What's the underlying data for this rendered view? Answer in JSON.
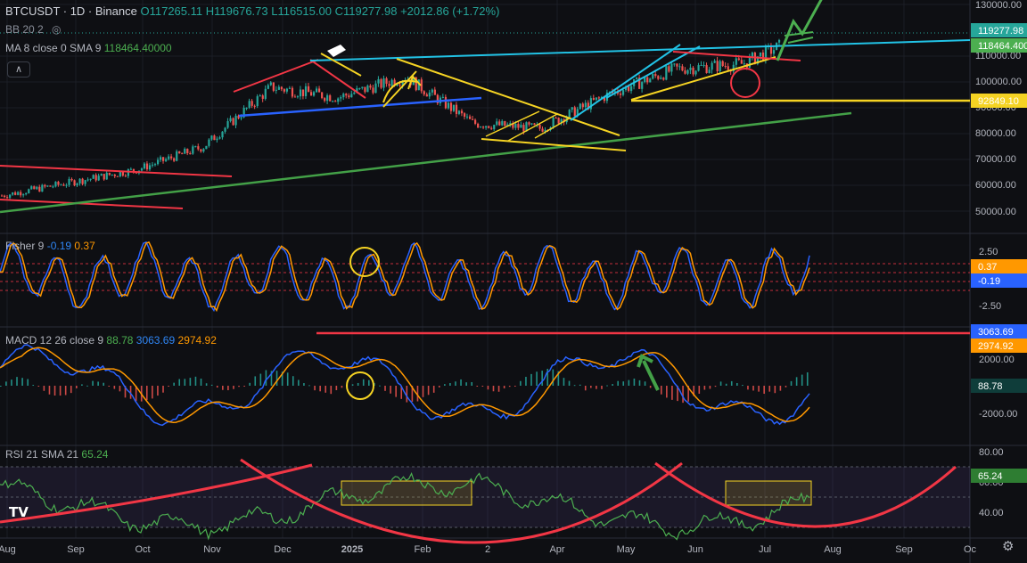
{
  "header": {
    "symbol": "BTCUSDT · 1D · Binance",
    "open": "O117265.11",
    "high": "H119676.73",
    "low": "L116515.00",
    "close": "C119277.98",
    "change": "+2012.86 (+1.72%)",
    "bb_label": "BB 20 2",
    "eye_icon": "eye-off-icon",
    "ma_label": "MA 8 close 0 SMA 9",
    "ma_value": "118464.40000",
    "collapse_icon": "chevron-up-icon"
  },
  "price_axis": {
    "ticks": [
      "130000.00",
      "110000.00",
      "100000.00",
      "90000.00",
      "80000.00",
      "70000.00",
      "60000.00",
      "50000.00"
    ],
    "tags": [
      {
        "text": "119277.98",
        "color": "#26a69a"
      },
      {
        "text": "118464.400",
        "color": "#4caf50"
      },
      {
        "text": "92849.10",
        "color": "#f5d323"
      }
    ]
  },
  "fisher": {
    "label": "Fisher 9",
    "v1": "-0.19",
    "v2": "0.37",
    "ticks": [
      "2.50",
      "-2.50"
    ],
    "tags": [
      {
        "text": "0.37",
        "color": "#ff9800"
      },
      {
        "text": "-0.19",
        "color": "#2962ff"
      }
    ]
  },
  "macd": {
    "label": "MACD 12 26 close 9",
    "hist": "88.78",
    "macd": "3063.69",
    "signal": "2974.92",
    "ticks": [
      "2000.00",
      "-2000.00"
    ],
    "tags": [
      {
        "text": "3063.69",
        "color": "#2962ff"
      },
      {
        "text": "2974.92",
        "color": "#ff9800"
      },
      {
        "text": "88.78",
        "color": "#0f3d3a",
        "fg": "#ffffff"
      }
    ]
  },
  "rsi": {
    "label": "RSI 21 SMA 21",
    "value": "65.24",
    "ticks": [
      "80.00",
      "60.00",
      "40.00"
    ],
    "tags": [
      {
        "text": "65.24",
        "color": "#2e7d32"
      }
    ]
  },
  "time_axis": [
    "Aug",
    "Sep",
    "Oct",
    "Nov",
    "Dec",
    "2025",
    "Feb",
    "2",
    "Apr",
    "May",
    "Jun",
    "Jul",
    "Aug",
    "Sep",
    "Oc"
  ],
  "logo": "TV",
  "settings_icon": "gear-icon",
  "colors": {
    "bg": "#0e0f13",
    "up": "#26a69a",
    "down": "#ef5350",
    "yellow": "#f5d323",
    "cyan": "#22c3e6",
    "red": "#f23645",
    "green": "#43a047",
    "blue": "#2962ff",
    "orange": "#ff9800"
  },
  "chart_data": [
    {
      "type": "candlestick",
      "title": "BTCUSDT · 1D · Binance",
      "x_ticks": [
        "Aug",
        "Sep",
        "Oct",
        "Nov",
        "Dec",
        "2025",
        "Feb",
        "2",
        "Apr",
        "May",
        "Jun",
        "Jul",
        "Aug",
        "Sep",
        "Oc"
      ],
      "ylim": [
        42000,
        135000
      ],
      "monthly_close": {
        "x": [
          "Aug",
          "Sep",
          "Oct",
          "Nov",
          "Dec",
          "2025",
          "Feb",
          "2",
          "Apr",
          "May",
          "Jun",
          "Jul"
        ],
        "y": [
          56000,
          61000,
          66000,
          75000,
          98000,
          94000,
          102000,
          84000,
          82000,
          95000,
          105000,
          107000
        ]
      },
      "last_close": 119277.98,
      "ma_value": 118464.4,
      "support_level": 92849.1
    },
    {
      "type": "line",
      "title": "Fisher 9",
      "series": [
        {
          "name": "Fisher",
          "last": -0.19
        },
        {
          "name": "Trigger",
          "last": 0.37
        }
      ],
      "y_ticks": [
        2.5,
        -2.5
      ]
    },
    {
      "type": "line",
      "title": "MACD 12 26 close 9",
      "series": [
        {
          "name": "MACD",
          "last": 3063.69
        },
        {
          "name": "Signal",
          "last": 2974.92
        },
        {
          "name": "Histogram",
          "last": 88.78
        }
      ],
      "y_ticks": [
        2000,
        -2000
      ]
    },
    {
      "type": "line",
      "title": "RSI 21 SMA 21",
      "series": [
        {
          "name": "RSI",
          "last": 65.24
        }
      ],
      "y_ticks": [
        80,
        60,
        40
      ]
    }
  ]
}
